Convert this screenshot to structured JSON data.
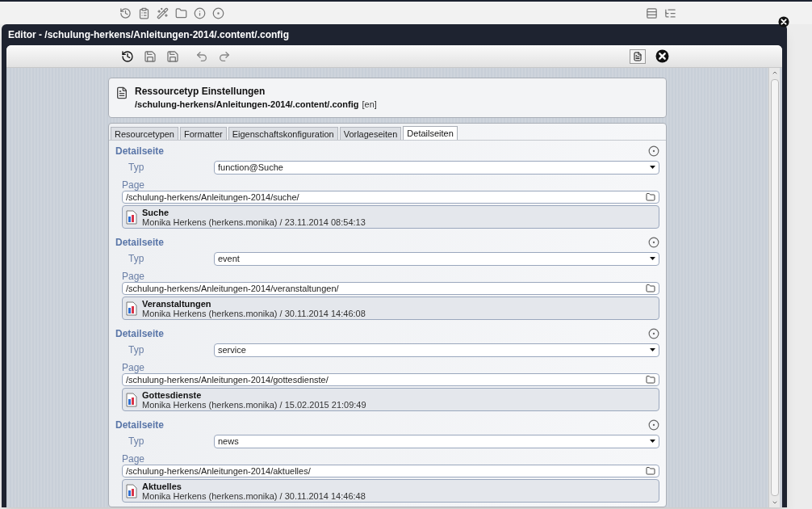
{
  "window": {
    "title": "Editor - /schulung-herkens/Anleitungen-2014/.content/.config"
  },
  "header": {
    "title": "Ressourcetyp Einstellungen",
    "path": "/schulung-herkens/Anleitungen-2014/.content/.config",
    "locale": "[en]"
  },
  "tabs": [
    {
      "label": "Resourcetypen",
      "selected": false
    },
    {
      "label": "Formatter",
      "selected": false
    },
    {
      "label": "Eigenschaftskonfiguration",
      "selected": false
    },
    {
      "label": "Vorlageseiten",
      "selected": false
    },
    {
      "label": "Detailseiten",
      "selected": true
    }
  ],
  "sections": [
    {
      "heading": "Detailseite",
      "type_label": "Typ",
      "type_value": "function@Suche",
      "page_label": "Page",
      "page_value": "/schulung-herkens/Anleitungen-2014/suche/",
      "resource": {
        "title": "Suche",
        "meta": "Monika Herkens (herkens.monika) / 23.11.2014 08:54:13"
      }
    },
    {
      "heading": "Detailseite",
      "type_label": "Typ",
      "type_value": "event",
      "page_label": "Page",
      "page_value": "/schulung-herkens/Anleitungen-2014/veranstaltungen/",
      "resource": {
        "title": "Veranstaltungen",
        "meta": "Monika Herkens (herkens.monika) / 30.11.2014 14:46:08"
      }
    },
    {
      "heading": "Detailseite",
      "type_label": "Typ",
      "type_value": "service",
      "page_label": "Page",
      "page_value": "/schulung-herkens/Anleitungen-2014/gottesdienste/",
      "resource": {
        "title": "Gottesdienste",
        "meta": "Monika Herkens (herkens.monika) / 15.02.2015 21:09:49"
      }
    },
    {
      "heading": "Detailseite",
      "type_label": "Typ",
      "type_value": "news",
      "page_label": "Page",
      "page_value": "/schulung-herkens/Anleitungen-2014/aktuelles/",
      "resource": {
        "title": "Aktuelles",
        "meta": "Monika Herkens (herkens.monika) / 30.11.2014 14:46:48"
      }
    }
  ]
}
